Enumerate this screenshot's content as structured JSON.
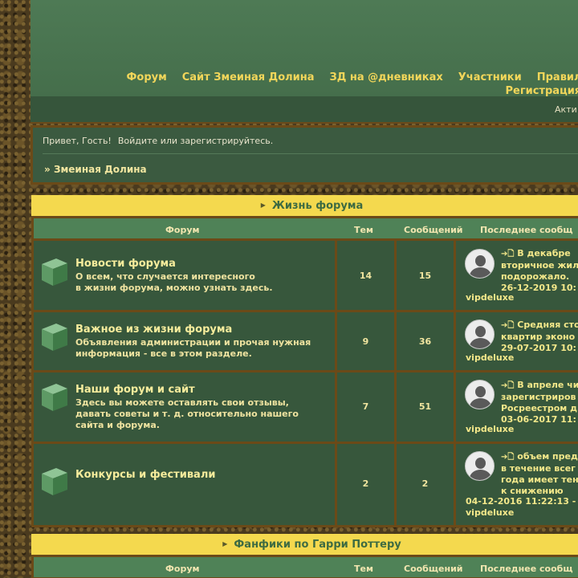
{
  "nav": {
    "items": [
      "Форум",
      "Сайт Змеиная Долина",
      "ЗД на @дневниках",
      "Участники",
      "Правила"
    ],
    "register": "Регистрация"
  },
  "subbar": {
    "active": "Акти"
  },
  "greet": {
    "hello": "Привет, Гость!",
    "login": "Войдите или зарегистрируйтесь.",
    "crumb_sep": "»",
    "crumb": "Змеиная Долина"
  },
  "columns": {
    "forum": "Форум",
    "topics": "Тем",
    "posts": "Сообщений",
    "last": "Последнее сообщ"
  },
  "categories": [
    {
      "title": "Жизнь форума",
      "forums": [
        {
          "title": "Новости форума",
          "desc1": "О всем, что случается интересного",
          "desc2": "в жизни форума, можно узнать здесь.",
          "desc3": "",
          "topics": "14",
          "posts": "15",
          "last1": "В декабре",
          "last2": "вторичное жил",
          "last3": "подорожало.",
          "date": "26-12-2019 10:",
          "user": "vipdeluxe"
        },
        {
          "title": "Важное из жизни форума",
          "desc1": "Объявления администрации и прочая нужная",
          "desc2": "информация - все в этом разделе.",
          "desc3": "",
          "topics": "9",
          "posts": "36",
          "last1": "Средняя сто",
          "last2": "квартир эконо",
          "last3": "29-07-2017 10:",
          "date": "",
          "user": "vipdeluxe"
        },
        {
          "title": "Наши форум и сайт",
          "desc1": "Здесь вы можете оставлять свои отзывы,",
          "desc2": "давать советы и т. д. относительно нашего",
          "desc3": "сайта и форума.",
          "topics": "7",
          "posts": "51",
          "last1": "В апреле чи",
          "last2": "зарегистриров",
          "last3": "Росреестром д",
          "date": "03-06-2017 11:",
          "user": "vipdeluxe"
        },
        {
          "title": "Конкурсы и фестивали",
          "desc1": "",
          "desc2": "",
          "desc3": "",
          "topics": "2",
          "posts": "2",
          "last1": "объем пред",
          "last2": "в течение всег",
          "last3": "года имеет тен",
          "last4": "к снижению",
          "date": "04-12-2016 11:22:13 -",
          "user": "vipdeluxe"
        }
      ]
    },
    {
      "title": "Фанфики по Гарри Поттеру"
    }
  ],
  "colors": {
    "accent": "#f4d94e",
    "header_green": "#4e7a55",
    "cell_green": "#37573c",
    "border_brown": "#6b4a18"
  }
}
